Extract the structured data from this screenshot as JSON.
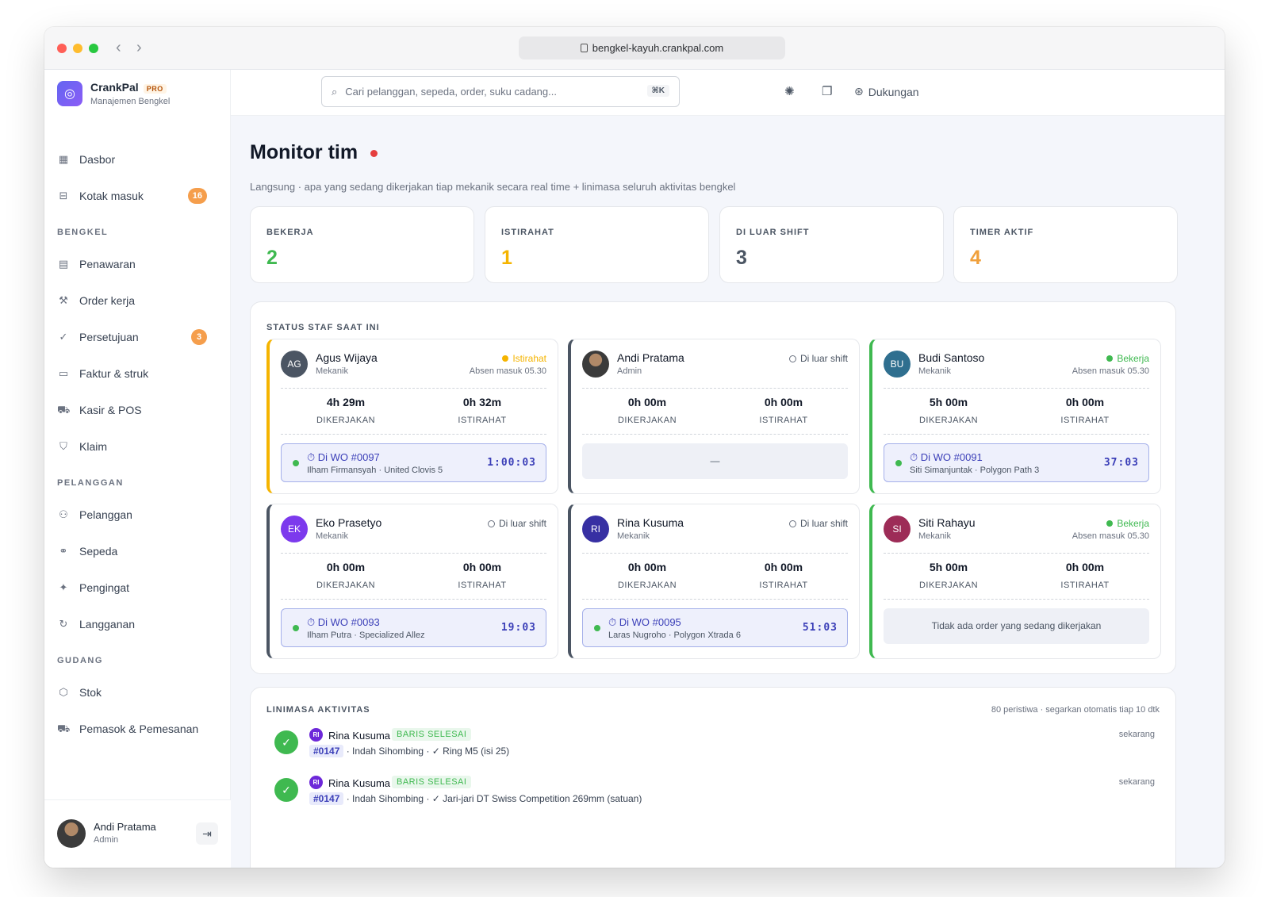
{
  "browser": {
    "url": "bengkel-kayuh.crankpal.com"
  },
  "brand": {
    "name": "CrankPal",
    "tier": "PRO",
    "subtitle": "Manajemen Bengkel"
  },
  "nav": {
    "dashboard": "Dasbor",
    "inbox": "Kotak masuk",
    "inbox_badge": "16",
    "section_bengkel": "BENGKEL",
    "quotes": "Penawaran",
    "work_orders": "Order kerja",
    "approvals": "Persetujuan",
    "approvals_badge": "3",
    "invoices": "Faktur & struk",
    "pos": "Kasir & POS",
    "claims": "Klaim",
    "section_pelanggan": "PELANGGAN",
    "customers": "Pelanggan",
    "bikes": "Sepeda",
    "reminders": "Pengingat",
    "subscriptions": "Langganan",
    "section_gudang": "GUDANG",
    "stock": "Stok",
    "suppliers": "Pemasok & Pemesanan"
  },
  "user": {
    "name": "Andi Pratama",
    "role": "Admin"
  },
  "topbar": {
    "search_placeholder": "Cari pelanggan, sepeda, order, suku cadang...",
    "shortcut": "⌘K",
    "support": "Dukungan"
  },
  "page": {
    "title": "Monitor tim",
    "subtitle": "Langsung · apa yang sedang dikerjakan tiap mekanik secara real time + linimasa seluruh aktivitas bengkel"
  },
  "stats": [
    {
      "label": "BEKERJA",
      "value": "2",
      "color": "#3fb950"
    },
    {
      "label": "ISTIRAHAT",
      "value": "1",
      "color": "#f5b400"
    },
    {
      "label": "DI LUAR SHIFT",
      "value": "3",
      "color": "#4b5563"
    },
    {
      "label": "TIMER AKTIF",
      "value": "4",
      "color": "#f0a03c"
    }
  ],
  "staff_panel": {
    "title": "STATUS STAF SAAT INI",
    "label_worked": "DIKERJAKAN",
    "label_break": "ISTIRAHAT"
  },
  "staff": [
    {
      "initials": "AG",
      "name": "Agus Wijaya",
      "role": "Mekanik",
      "status": "Istirahat",
      "since": "Absen masuk 05.30",
      "worked": "4h 29m",
      "break": "0h 32m",
      "wo": "Di WO #0097",
      "wo_detail": "Ilham Firmansyah · United Clovis 5",
      "timer": "1:00:03"
    },
    {
      "initials": "",
      "name": "Andi Pratama",
      "role": "Admin",
      "status": "Di luar shift",
      "since": "",
      "worked": "0h 00m",
      "break": "0h 00m",
      "empty": "—"
    },
    {
      "initials": "BU",
      "name": "Budi Santoso",
      "role": "Mekanik",
      "status": "Bekerja",
      "since": "Absen masuk 05.30",
      "worked": "5h 00m",
      "break": "0h 00m",
      "wo": "Di WO #0091",
      "wo_detail": "Siti Simanjuntak · Polygon Path 3",
      "timer": "37:03"
    },
    {
      "initials": "EK",
      "name": "Eko Prasetyo",
      "role": "Mekanik",
      "status": "Di luar shift",
      "since": "",
      "worked": "0h 00m",
      "break": "0h 00m",
      "wo": "Di WO #0093",
      "wo_detail": "Ilham Putra · Specialized Allez",
      "timer": "19:03"
    },
    {
      "initials": "RI",
      "name": "Rina Kusuma",
      "role": "Mekanik",
      "status": "Di luar shift",
      "since": "",
      "worked": "0h 00m",
      "break": "0h 00m",
      "wo": "Di WO #0095",
      "wo_detail": "Laras Nugroho · Polygon Xtrada 6",
      "timer": "51:03"
    },
    {
      "initials": "SI",
      "name": "Siti Rahayu",
      "role": "Mekanik",
      "status": "Bekerja",
      "since": "Absen masuk 05.30",
      "worked": "5h 00m",
      "break": "0h 00m",
      "empty": "Tidak ada order yang sedang dikerjakan"
    }
  ],
  "timeline": {
    "title": "LINIMASA AKTIVITAS",
    "meta": "80 peristiwa · segarkan otomatis tiap 10 dtk",
    "events": [
      {
        "avatar": "RI",
        "name": "Rina Kusuma",
        "tag": "BARIS SELESAI",
        "wo": "#0147",
        "text": " · Indah Sihombing · ✓ Ring M5 (isi 25)",
        "time": "sekarang"
      },
      {
        "avatar": "RI",
        "name": "Rina Kusuma",
        "tag": "BARIS SELESAI",
        "wo": "#0147",
        "text": " · Indah Sihombing · ✓ Jari-jari DT Swiss Competition 269mm (satuan)",
        "time": "sekarang"
      }
    ]
  }
}
